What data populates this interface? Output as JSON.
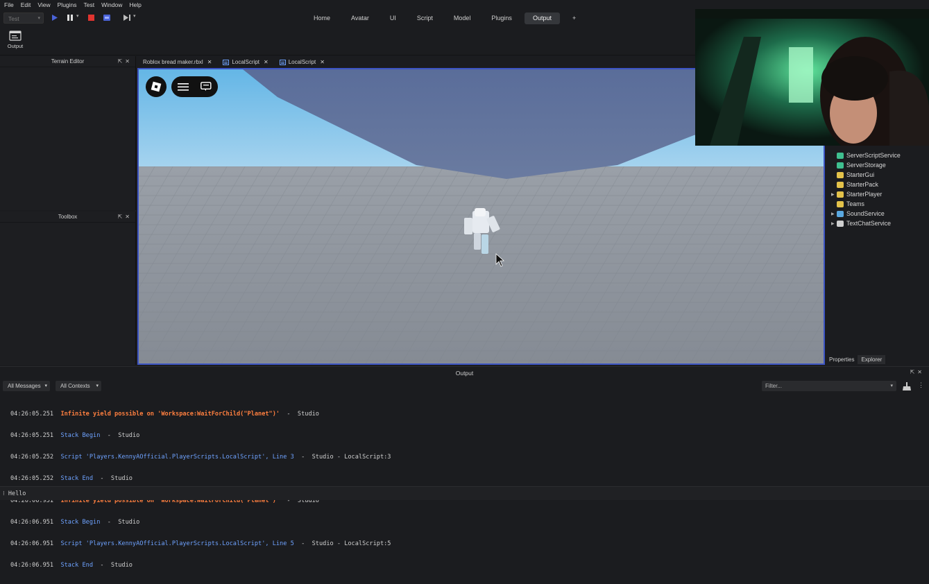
{
  "menu": [
    "File",
    "Edit",
    "View",
    "Plugins",
    "Test",
    "Window",
    "Help"
  ],
  "toolbar": {
    "mode_select": "Test"
  },
  "tabs": [
    {
      "label": "Home"
    },
    {
      "label": "Avatar"
    },
    {
      "label": "UI"
    },
    {
      "label": "Script"
    },
    {
      "label": "Model"
    },
    {
      "label": "Plugins"
    },
    {
      "label": "Output",
      "active": true
    },
    {
      "label": "+"
    }
  ],
  "ribbon": {
    "output_label": "Output"
  },
  "panels": {
    "terrain_editor": "Terrain Editor",
    "toolbox": "Toolbox"
  },
  "doc_tabs": [
    "Roblox bread maker.rbxl",
    "LocalScript",
    "LocalScript"
  ],
  "explorer": {
    "items": [
      {
        "label": "ServerScriptService",
        "color": "#3fbf8f"
      },
      {
        "label": "ServerStorage",
        "color": "#3fbf8f"
      },
      {
        "label": "StarterGui",
        "color": "#e3c24a"
      },
      {
        "label": "StarterPack",
        "color": "#e3c24a"
      },
      {
        "label": "StarterPlayer",
        "color": "#e3c24a",
        "expandable": true
      },
      {
        "label": "Teams",
        "color": "#e3c24a"
      },
      {
        "label": "SoundService",
        "color": "#5aa8e0",
        "expandable": true
      },
      {
        "label": "TextChatService",
        "color": "#cfcfcf",
        "expandable": true
      }
    ]
  },
  "right_tabs": [
    "Properties",
    "Explorer"
  ],
  "output": {
    "title": "Output",
    "messages_filter": "All Messages",
    "contexts_filter": "All Contexts",
    "filter_placeholder": "Filter...",
    "lines": [
      {
        "ts": "04:26:05.251",
        "kind": "warn",
        "text": "Infinite yield possible on 'Workspace:WaitForChild(\"Planet\")'",
        "suffix": "  -  Studio"
      },
      {
        "ts": "04:26:05.251",
        "kind": "info",
        "text": "Stack Begin",
        "suffix": "  -  Studio"
      },
      {
        "ts": "04:26:05.252",
        "kind": "info",
        "text": "Script 'Players.KennyAOfficial.PlayerScripts.LocalScript', Line 3",
        "suffix": "  -  Studio - LocalScript:3"
      },
      {
        "ts": "04:26:05.252",
        "kind": "info",
        "text": "Stack End",
        "suffix": "  -  Studio"
      },
      {
        "ts": "04:26:06.951",
        "kind": "warn",
        "text": "Infinite yield possible on 'Workspace:WaitForChild(\"Planet\")'",
        "suffix": "  -  Studio"
      },
      {
        "ts": "04:26:06.951",
        "kind": "info",
        "text": "Stack Begin",
        "suffix": "  -  Studio"
      },
      {
        "ts": "04:26:06.951",
        "kind": "info",
        "text": "Script 'Players.KennyAOfficial.PlayerScripts.LocalScript', Line 5",
        "suffix": "  -  Studio - LocalScript:5"
      },
      {
        "ts": "04:26:06.951",
        "kind": "info",
        "text": "Stack End",
        "suffix": "  -  Studio"
      }
    ],
    "command": "Hello"
  }
}
